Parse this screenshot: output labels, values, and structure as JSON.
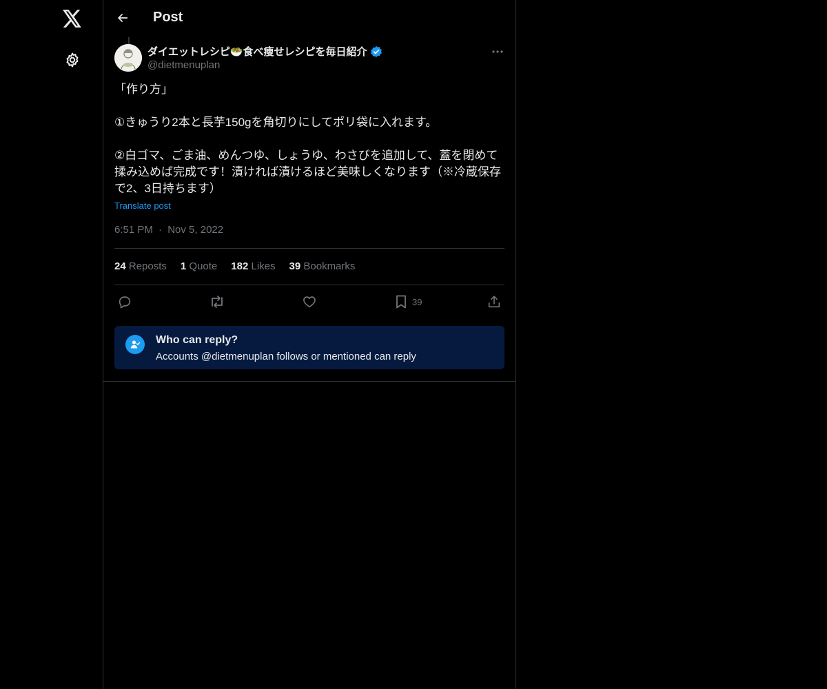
{
  "header": {
    "title": "Post"
  },
  "author": {
    "display_name": "ダイエットレシピ🥗食べ痩せレシピを毎日紹介",
    "handle": "@dietmenuplan",
    "verified": true
  },
  "post": {
    "text": "「作り方」\n\n①きゅうり2本と長芋150gを角切りにしてポリ袋に入れます。\n\n②白ゴマ、ごま油、めんつゆ、しょうゆ、わさびを追加して、蓋を閉めて揉み込めば完成です！漬ければ漬けるほど美味しくなります（※冷蔵保存で2、3日持ちます）",
    "translate_label": "Translate post",
    "time": "6:51 PM",
    "separator": "·",
    "date": "Nov 5, 2022"
  },
  "stats": {
    "reposts_count": "24",
    "reposts_label": "Reposts",
    "quotes_count": "1",
    "quotes_label": "Quote",
    "likes_count": "182",
    "likes_label": "Likes",
    "bookmarks_count": "39",
    "bookmarks_label": "Bookmarks"
  },
  "actions": {
    "bookmark_count": "39"
  },
  "reply_settings": {
    "title": "Who can reply?",
    "description": "Accounts @dietmenuplan follows or mentioned can reply"
  },
  "colors": {
    "background": "#000000",
    "accent": "#1d9bf0",
    "text_primary": "#e7e9ea",
    "text_secondary": "#71767b",
    "reply_box_bg": "#061a40",
    "border": "#2f3336"
  },
  "icons": {
    "nav": [
      "x-logo-icon",
      "gear-icon"
    ],
    "header": "back-arrow-icon",
    "actions": [
      "reply-icon",
      "repost-icon",
      "like-icon",
      "bookmark-icon",
      "share-icon"
    ]
  }
}
